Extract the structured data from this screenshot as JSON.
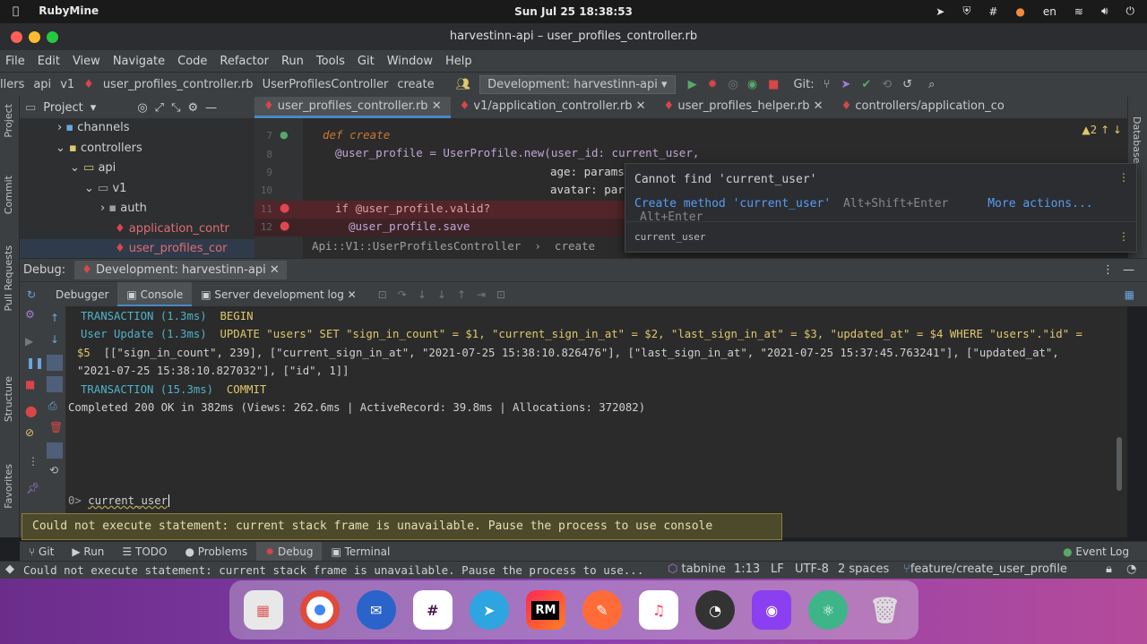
{
  "topbar": {
    "app": "RubyMine",
    "datetime": "Sun Jul 25  18:38:53",
    "lang": "en"
  },
  "window": {
    "title": "harvestinn-api – user_profiles_controller.rb"
  },
  "menu": [
    "File",
    "Edit",
    "View",
    "Navigate",
    "Code",
    "Refactor",
    "Run",
    "Tools",
    "Git",
    "Window",
    "Help"
  ],
  "navbar": {
    "c1": "llers",
    "c2": "api",
    "c3": "v1",
    "c4": "user_profiles_controller.rb",
    "c5": "UserProfilesController",
    "c6": "create",
    "run_config": "Development: harvestinn-api",
    "git_label": "Git:"
  },
  "sidebar": {
    "project": "Project",
    "commit": "Commit",
    "pull_requests": "Pull Requests",
    "structure": "Structure",
    "favorites": "Favorites",
    "database": "Database"
  },
  "project_panel": {
    "title": "Project",
    "tree": [
      "channels",
      "controllers",
      "api",
      "v1",
      "auth",
      "application_contr",
      "user_profiles_cor"
    ]
  },
  "editor": {
    "tabs": [
      "user_profiles_controller.rb",
      "v1/application_controller.rb",
      "user_profiles_helper.rb",
      "controllers/application_co"
    ],
    "warnings": "2",
    "lines": [
      {
        "n": "7",
        "text": "def create"
      },
      {
        "n": "8",
        "text": "@user_profile = UserProfile.new(user_id: current_user,"
      },
      {
        "n": "9",
        "text": "age: params"
      },
      {
        "n": "10",
        "text": "avatar: par"
      },
      {
        "n": "11",
        "text": "if @user_profile.valid?"
      },
      {
        "n": "12",
        "text": "@user_profile.save"
      }
    ],
    "breadcrumb": "Api::V1::UserProfilesController  ›  create"
  },
  "popup": {
    "message": "Cannot find 'current_user'",
    "action": "Create method 'current_user'",
    "action_key": "Alt+Shift+Enter",
    "more": "More actions...",
    "more_key": "Alt+Enter",
    "footer": "current_user"
  },
  "debug": {
    "label": "Debug:",
    "config": "Development: harvestinn-api",
    "tabs": [
      "Debugger",
      "Console",
      "Server development log"
    ]
  },
  "console": {
    "l1a": "TRANSACTION (1.3ms)",
    "l1b": "BEGIN",
    "l2a": "User Update (1.3ms)",
    "l2b": "UPDATE \"users\" SET \"sign_in_count\" = $1, \"current_sign_in_at\" = $2, \"last_sign_in_at\" = $3, \"updated_at\" = $4 WHERE \"users\".\"id\" =",
    "l3a": "$5",
    "l3b": "[[\"sign_in_count\", 239], [\"current_sign_in_at\", \"2021-07-25 15:38:10.826476\"], [\"last_sign_in_at\", \"2021-07-25 15:37:45.763241\"], [\"updated_at\",",
    "l4": "\"2021-07-25 15:38:10.827032\"], [\"id\", 1]]",
    "l5a": "TRANSACTION (15.3ms)",
    "l5b": "COMMIT",
    "l6": "Completed 200 OK in 382ms (Views: 262.6ms | ActiveRecord: 39.8ms | Allocations: 372082)",
    "prompt": "0>",
    "input": "current_user"
  },
  "warning": "Could not execute statement: current stack frame is unavailable. Pause the process to use console interpreter.",
  "bottom_tabs": [
    "Git",
    "Run",
    "TODO",
    "Problems",
    "Debug",
    "Terminal"
  ],
  "event_log": "Event Log",
  "status": {
    "message": "Could not execute statement: current stack frame is unavailable. Pause the process to use...",
    "tabnine": "tabnine",
    "pos": "1:13",
    "eol": "LF",
    "enc": "UTF-8",
    "indent": "2 spaces",
    "branch": "feature/create_user_profile"
  },
  "dock": [
    "Launchpad",
    "Chrome",
    "Mail",
    "Slack",
    "Telegram",
    "RubyMine",
    "Postman",
    "Music",
    "Clock",
    "Podcasts",
    "Atom",
    "Trash"
  ],
  "colors": {
    "accent": "#4a88c7",
    "warning_bg": "#4d4a2b",
    "link": "#589df6"
  }
}
